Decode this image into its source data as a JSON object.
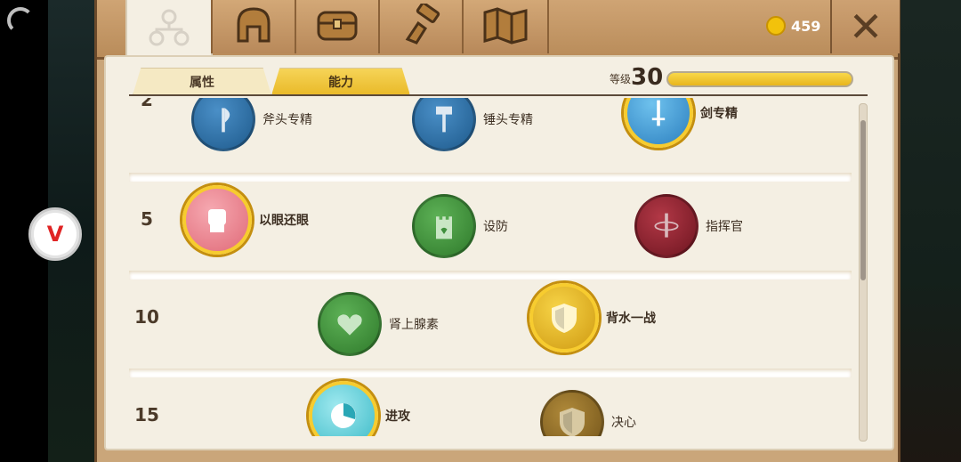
{
  "topbar": {
    "coins": "459",
    "close_symbol": "✕",
    "tab_icons": [
      "hierarchy-icon",
      "helmet-icon",
      "chest-icon",
      "hammer-hand-icon",
      "map-icon"
    ]
  },
  "panel": {
    "subtabs": [
      {
        "label": "属性"
      },
      {
        "label": "能力"
      }
    ],
    "level_label": "等级",
    "level_value": "30",
    "xp_progress": 1.0
  },
  "rows": [
    {
      "level": "2",
      "abilities": [
        {
          "name": "斧头专精",
          "icon": "axe-icon"
        },
        {
          "name": "锤头专精",
          "icon": "hammer-icon"
        },
        {
          "name": "剑专精",
          "icon": "sword-icon"
        }
      ]
    },
    {
      "level": "5",
      "abilities": [
        {
          "name": "以眼还眼",
          "icon": "fist-icon"
        },
        {
          "name": "设防",
          "icon": "tower-icon"
        },
        {
          "name": "指挥官",
          "icon": "commander-sword-icon"
        }
      ]
    },
    {
      "level": "10",
      "abilities": [
        {
          "name": "肾上腺素",
          "icon": "heart-icon"
        },
        {
          "name": "背水一战",
          "icon": "shield-icon"
        }
      ]
    },
    {
      "level": "15",
      "abilities": [
        {
          "name": "进攻",
          "icon": "clock-icon"
        },
        {
          "name": "决心",
          "icon": "shield-icon"
        }
      ]
    }
  ],
  "colors": {
    "gold": "#f7cc2f",
    "blue": "#2d6fa3",
    "green": "#3f8f3c",
    "red": "#8a1f2a",
    "olive": "#8c6a22"
  }
}
